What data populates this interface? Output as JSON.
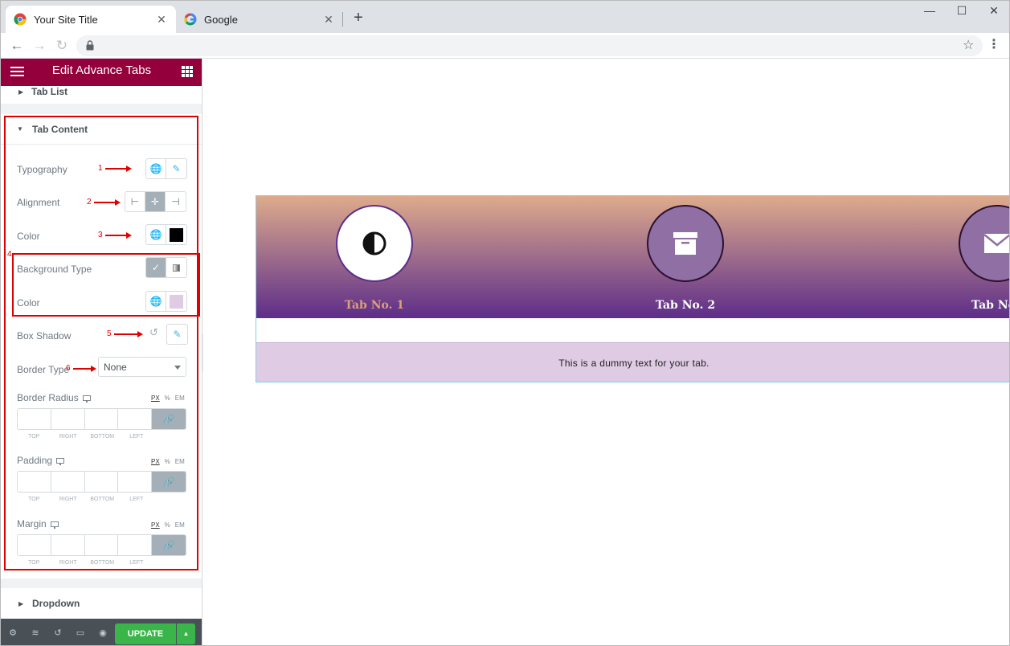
{
  "browser": {
    "tabs": [
      {
        "title": "Your Site Title",
        "icon": "chrome-icon"
      },
      {
        "title": "Google",
        "icon": "google-icon"
      }
    ],
    "new_tab": "+",
    "window": {
      "minimize": "—",
      "maximize": "☐",
      "close": "✕"
    }
  },
  "panel": {
    "header_title": "Edit Advance Tabs",
    "tab_list": "Tab List",
    "tab_content": "Tab Content",
    "rows": {
      "typography": "Typography",
      "alignment": "Alignment",
      "color": "Color",
      "background_type": "Background Type",
      "bg_color": "Color",
      "box_shadow": "Box Shadow",
      "border_type": "Border Type",
      "border_type_value": "None",
      "border_radius": "Border Radius",
      "padding": "Padding",
      "margin": "Margin"
    },
    "units": [
      "PX",
      "%",
      "EM"
    ],
    "dim_labels": [
      "TOP",
      "RIGHT",
      "BOTTOM",
      "LEFT"
    ],
    "markers": [
      "1",
      "2",
      "3",
      "4",
      "5",
      "6"
    ],
    "dropdown": "Dropdown",
    "update": "UPDATE"
  },
  "preview": {
    "tabs": [
      "Tab No. 1",
      "Tab No. 2",
      "Tab No"
    ],
    "content_text": "This is a dummy text for your tab."
  },
  "colors": {
    "header": "#93003c",
    "update": "#39b54a",
    "annotation": "#e00000",
    "content_bg": "#dfcbe4"
  }
}
